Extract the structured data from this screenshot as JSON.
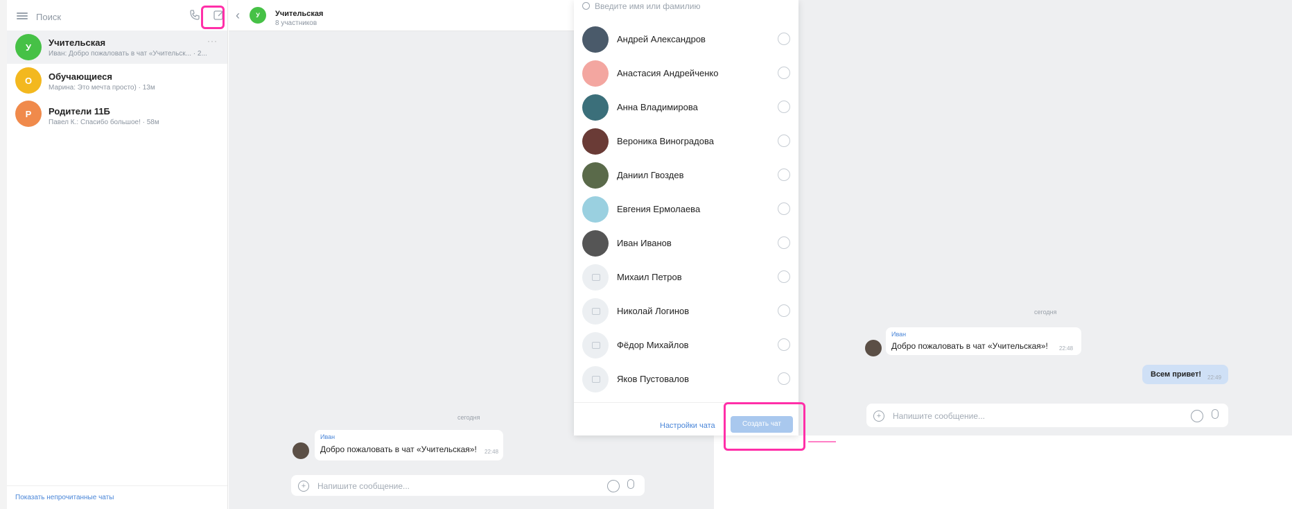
{
  "left": {
    "search_placeholder": "Поиск",
    "chats": [
      {
        "initial": "У",
        "title": "Учительская",
        "preview_author": "Иван:",
        "preview_text": "Добро пожаловать в чат «Учительск... · 2...",
        "color": "#46c146"
      },
      {
        "initial": "О",
        "title": "Обучающиеся",
        "preview_author": "Марина:",
        "preview_text": "Это мечта просто) · 13м",
        "color": "#f3b81f"
      },
      {
        "initial": "Р",
        "title": "Родители 11Б",
        "preview_author": "Павел К.:",
        "preview_text": "Спасибо большое! · 58м",
        "color": "#f08a4b"
      }
    ],
    "show_unread": "Показать непрочитанные чаты"
  },
  "middle": {
    "title": "Учительская",
    "subtitle": "8 участников",
    "avatar_initial": "У",
    "date": "сегодня",
    "message_author": "Иван",
    "message_text": "Добро пожаловать в чат «Учительская»!",
    "message_time": "22:48",
    "composer_placeholder": "Напишите сообщение..."
  },
  "picker": {
    "search_placeholder": "Введите имя или фамилию",
    "contacts": [
      {
        "name": "Андрей Александров",
        "ava": "#4a5a6a"
      },
      {
        "name": "Анастасия Андрейченко",
        "ava": "#f3a6a0"
      },
      {
        "name": "Анна Владимирова",
        "ava": "#3b6f7a"
      },
      {
        "name": "Вероника Виноградова",
        "ava": "#6a3b36"
      },
      {
        "name": "Даниил Гвоздев",
        "ava": "#5a6a4a"
      },
      {
        "name": "Евгения Ермолаева",
        "ava": "#9ad0e0"
      },
      {
        "name": "Иван Иванов",
        "ava": "#555555"
      },
      {
        "name": "Михаил Петров",
        "ava": "#eceff2"
      },
      {
        "name": "Николай Логинов",
        "ava": "#eceff2"
      },
      {
        "name": "Фёдор Михайлов",
        "ava": "#eceff2"
      },
      {
        "name": "Яков Пустовалов",
        "ava": "#eceff2"
      }
    ],
    "settings_link": "Настройки чата",
    "create_button": "Создать чат"
  },
  "right": {
    "date": "сегодня",
    "message_author": "Иван",
    "message_text": "Добро пожаловать в чат «Учительская»!",
    "message_time": "22:48",
    "own_message": "Всем привет!",
    "own_time": "22:49",
    "composer_placeholder": "Напишите сообщение..."
  },
  "colors": {
    "highlight": "#ff2fa8",
    "link": "#4a86d8",
    "create_button_disabled": "#a9c8ee"
  }
}
